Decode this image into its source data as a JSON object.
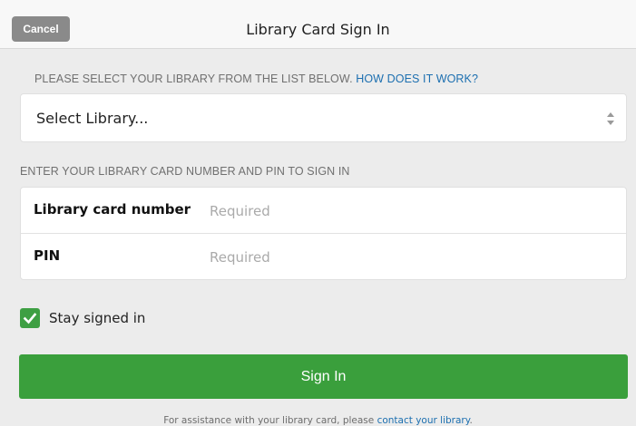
{
  "header": {
    "cancel_label": "Cancel",
    "title": "Library Card Sign In"
  },
  "library_section": {
    "label": "PLEASE SELECT YOUR LIBRARY FROM THE LIST BELOW.",
    "help_link": "HOW DOES IT WORK?",
    "select": {
      "selected_value": "Select Library...",
      "icon": "sort-arrows-icon"
    }
  },
  "card_section": {
    "label": "ENTER YOUR LIBRARY CARD NUMBER AND PIN TO SIGN IN",
    "fields": [
      {
        "label": "Library card number",
        "placeholder": "Required",
        "value": ""
      },
      {
        "label": "PIN",
        "placeholder": "Required",
        "value": ""
      }
    ]
  },
  "stay_signed_in": {
    "label": "Stay signed in",
    "checked": true,
    "icon": "check-icon",
    "color": "#3e9f43"
  },
  "sign_in": {
    "label": "Sign In",
    "color": "#3a9f3c"
  },
  "footer": {
    "text": "For assistance with your library card, please ",
    "link": "contact your library",
    "end": "."
  },
  "colors": {
    "link": "#1c6fb0",
    "cancel_button": "#8a8a8a",
    "background": "#ececec"
  }
}
